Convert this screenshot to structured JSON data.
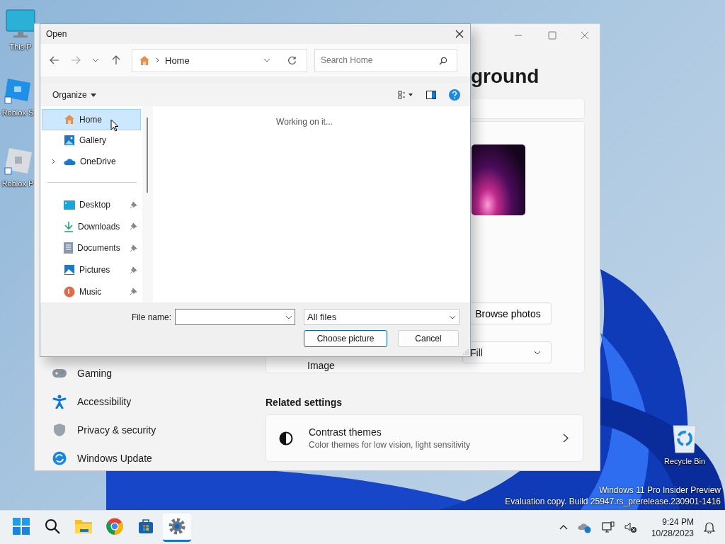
{
  "desktop": {
    "icons": [
      {
        "label": "This P",
        "kind": "monitor"
      },
      {
        "label": "Roblox S",
        "kind": "studio"
      },
      {
        "label": "Roblox P",
        "kind": "player"
      },
      {
        "label": "Recycle Bin",
        "kind": "recycle"
      }
    ],
    "watermark": [
      "Windows 11 Pro Insider Preview",
      "Evaluation copy. Build 25947.rs_prerelease.230901-1416"
    ]
  },
  "settings": {
    "heading": "ground",
    "browse_button": "Browse photos",
    "fit_dropdown": "Fill",
    "row_label": "Image",
    "nav": [
      {
        "label": "Gaming",
        "kind": "gaming"
      },
      {
        "label": "Accessibility",
        "kind": "accessibility"
      },
      {
        "label": "Privacy & security",
        "kind": "privacy"
      },
      {
        "label": "Windows Update",
        "kind": "update"
      }
    ],
    "related_title": "Related settings",
    "related": [
      {
        "title": "Contrast themes",
        "subtitle": "Color themes for low vision, light sensitivity"
      }
    ]
  },
  "dialog": {
    "title": "Open",
    "address": "Home",
    "search": {
      "placeholder": "Search Home"
    },
    "organize": "Organize",
    "nav": [
      {
        "label": "Home",
        "kind": "home",
        "selected": true,
        "pinned": false,
        "expandable": false
      },
      {
        "label": "Gallery",
        "kind": "gallery",
        "selected": false,
        "pinned": false,
        "expandable": false
      },
      {
        "label": "OneDrive",
        "kind": "cloud",
        "selected": false,
        "pinned": false,
        "expandable": true
      },
      {
        "label": "Desktop",
        "kind": "desktop",
        "selected": false,
        "pinned": true,
        "expandable": false
      },
      {
        "label": "Downloads",
        "kind": "downloads",
        "selected": false,
        "pinned": true,
        "expandable": false
      },
      {
        "label": "Documents",
        "kind": "documents",
        "selected": false,
        "pinned": true,
        "expandable": false
      },
      {
        "label": "Pictures",
        "kind": "pictures",
        "selected": false,
        "pinned": true,
        "expandable": false
      },
      {
        "label": "Music",
        "kind": "music",
        "selected": false,
        "pinned": true,
        "expandable": false
      }
    ],
    "status": "Working on it...",
    "file_name_label": "File name:",
    "filter": "All files",
    "buttons": [
      "Choose picture",
      "Cancel"
    ]
  },
  "taskbar": {
    "apps": [
      {
        "kind": "start",
        "active": false
      },
      {
        "kind": "search",
        "active": false
      },
      {
        "kind": "explorer",
        "active": false
      },
      {
        "kind": "chrome",
        "active": false
      },
      {
        "kind": "store",
        "active": false
      },
      {
        "kind": "settings",
        "active": true
      }
    ],
    "time": "9:24 PM",
    "date": "10/28/2023"
  }
}
